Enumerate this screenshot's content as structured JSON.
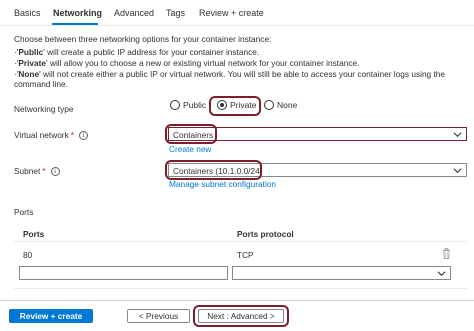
{
  "tabs": [
    "Basics",
    "Networking",
    "Advanced",
    "Tags",
    "Review + create"
  ],
  "active_tab": "Networking",
  "description": {
    "intro": "Choose between three networking options for your container instance:",
    "bullets": [
      {
        "term": "Public",
        "text": " will create a public IP address for your container instance."
      },
      {
        "term": "Private",
        "text": " will allow you to choose a new or existing virtual network for your container instance."
      },
      {
        "term": "None",
        "text": " will not create either a public IP or virtual network. You will still be able to access your container logs using the command line."
      }
    ]
  },
  "networking_type": {
    "label": "Networking type",
    "options": [
      "Public",
      "Private",
      "None"
    ],
    "selected": "Private"
  },
  "virtual_network": {
    "label": "Virtual network",
    "required": "*",
    "value": "Containers",
    "link": "Create new"
  },
  "subnet": {
    "label": "Subnet",
    "required": "*",
    "value": "Containers (10.1.0.0/24)",
    "link": "Manage subnet configuration"
  },
  "ports": {
    "section_label": "Ports",
    "columns": [
      "Ports",
      "Ports protocol"
    ],
    "rows": [
      {
        "port": "80",
        "protocol": "TCP"
      }
    ],
    "new_row": {
      "port": "",
      "protocol": ""
    }
  },
  "footer": {
    "review_create": "Review + create",
    "previous": "< Previous",
    "next": "Next : Advanced >"
  },
  "colors": {
    "accent": "#0078d4",
    "highlight": "#7a1f2b",
    "required": "#a4262c"
  }
}
